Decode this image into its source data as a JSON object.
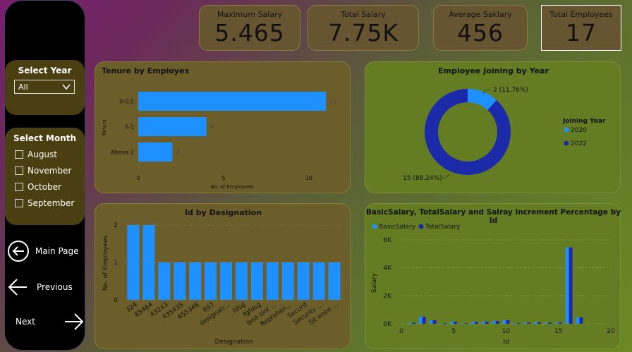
{
  "sidebar": {
    "year_slicer": {
      "title": "Select Year",
      "selected": "All"
    },
    "month_slicer": {
      "title": "Select Month",
      "items": [
        "August",
        "November",
        "October",
        "September"
      ]
    },
    "nav": {
      "main_page": "Main Page",
      "previous": "Previous",
      "next": "Next"
    }
  },
  "kpis": [
    {
      "label": "Maximum Salary",
      "value": "5.465"
    },
    {
      "label": "Total Salary",
      "value": "7.75K"
    },
    {
      "label": "Average Saklary",
      "value": "456"
    },
    {
      "label": "Total Employees",
      "value": "17"
    }
  ],
  "colors": {
    "blue": "#1e90ff",
    "dark_blue": "#1a2aa8",
    "bar_label": "#444444"
  },
  "chart_data": [
    {
      "type": "bar",
      "orientation": "horizontal",
      "title": "Tenure by Employes",
      "ylabel": "Tenure",
      "xlabel": "No. of Employees",
      "categories": [
        "0-0.5",
        "0-1",
        "Above 2"
      ],
      "values": [
        11,
        4,
        2
      ],
      "xlim": [
        0,
        11
      ],
      "xticks": [
        "0",
        "5",
        "10"
      ]
    },
    {
      "type": "pie",
      "title": "Employee Joining by Year",
      "legend_title": "Joining Year",
      "legend_placement": "right",
      "slices": [
        {
          "name": "2020",
          "value": 2,
          "label": "2 (11.76%)"
        },
        {
          "name": "2022",
          "value": 15,
          "label": "15 (88.24%)"
        }
      ]
    },
    {
      "type": "bar",
      "title": "Id by Designation",
      "xlabel": "Designation",
      "ylabel": "No. of Employees",
      "categories": [
        "324",
        "65464",
        "43243",
        "435435",
        "655346",
        "657",
        "designati...",
        "fdsg",
        "fgfdsg",
        "Ipsa sint ...",
        "Reprehen...",
        "Securit",
        "Security ...",
        "Sit enim ..."
      ],
      "values": [
        2,
        2,
        1,
        1,
        1,
        1,
        1,
        1,
        1,
        1,
        1,
        1,
        1,
        1
      ],
      "ylim": [
        0,
        2
      ],
      "yticks": [
        "0",
        "1",
        "2"
      ]
    },
    {
      "type": "bar",
      "title": "BasicSalary, TotalSalary and Salray Increment Percentage by Id",
      "xlabel": "Id",
      "ylabel": "Salary",
      "x": [
        1,
        2,
        3,
        4,
        5,
        6,
        7,
        8,
        9,
        10,
        11,
        12,
        13,
        14,
        15,
        16,
        17
      ],
      "series": [
        {
          "name": "BasicSalary",
          "values": [
            80,
            500,
            250,
            40,
            150,
            40,
            130,
            150,
            200,
            250,
            60,
            80,
            110,
            80,
            90,
            5465,
            460
          ]
        },
        {
          "name": "TotalSalary",
          "values": [
            80,
            500,
            250,
            40,
            150,
            40,
            130,
            150,
            200,
            250,
            60,
            80,
            110,
            80,
            90,
            5465,
            460
          ]
        }
      ],
      "xlim": [
        0,
        20
      ],
      "ylim": [
        0,
        6000
      ],
      "xticks": [
        "0",
        "5",
        "10",
        "15",
        "20"
      ],
      "yticks": [
        "0K",
        "2K",
        "4K",
        "6K"
      ]
    }
  ]
}
